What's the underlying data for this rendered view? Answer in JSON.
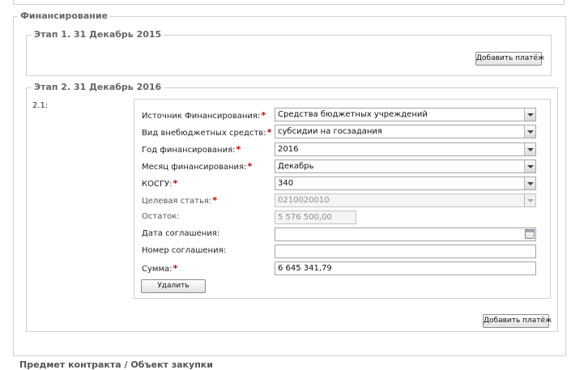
{
  "section": {
    "title": "Финансирование"
  },
  "stage1": {
    "title": "Этап 1. 31 Декабрь 2015",
    "add_payment_label": "Добавить платёж"
  },
  "stage2": {
    "title": "Этап 2. 31 Декабрь 2016",
    "item_label": "2.1:",
    "add_payment_label": "Добавить платёж",
    "delete_label": "Удалить",
    "fields": {
      "source": {
        "label": "Источник Финансирования:",
        "value": "Средства бюджетных учреждений",
        "required": "*"
      },
      "extrabudget_type": {
        "label": "Вид внебюджетных средств:",
        "value": "субсидии на госзадания",
        "required": "*"
      },
      "year": {
        "label": "Год финансирования:",
        "value": "2016",
        "required": "*"
      },
      "month": {
        "label": "Месяц финансирования:",
        "value": "Декабрь",
        "required": "*"
      },
      "kosgu": {
        "label": "КОСГУ:",
        "value": "340",
        "required": "*"
      },
      "target_article": {
        "label": "Целевая статья:",
        "value": "0210020010",
        "required": "*"
      },
      "balance": {
        "label": "Остаток:",
        "value": "5 576 500,00"
      },
      "agreement_date": {
        "label": "Дата соглашения:",
        "value": ""
      },
      "agreement_number": {
        "label": "Номер соглашения:",
        "value": ""
      },
      "amount": {
        "label": "Сумма:",
        "value": "6 645 341,79",
        "required": "*"
      }
    }
  },
  "next_section": {
    "title": "Предмет контракта / Объект закупки"
  },
  "icons": {
    "dropdown": "chevron-down-icon",
    "calendar": "calendar-icon"
  }
}
